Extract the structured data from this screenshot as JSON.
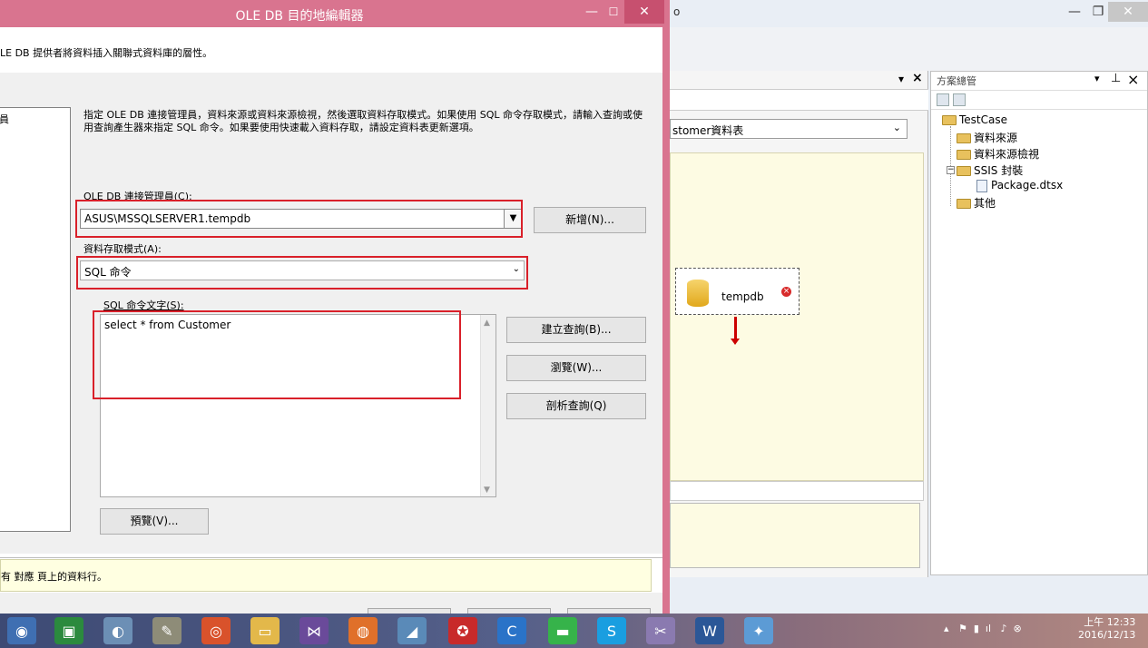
{
  "dialog": {
    "title": "OLE DB 目的地編輯器",
    "description": "LE DB 提供者將資料插入關聯式資料庫的層性。",
    "nav_item": "員",
    "instructions": "指定 OLE DB 連接管理員，資料來源或資料來源檢視，然後選取資料存取模式。如果使用 SQL 命令存取模式，請輸入查詢或使用查詢產生器來指定 SQL 命令。如果要使用快速載入資料存取，請設定資料表更新選項。",
    "connection_label": "OLE DB 連接管理員(C):",
    "connection_value": "ASUS\\MSSQLSERVER1.tempdb",
    "new_button": "新增(N)...",
    "mode_label": "資料存取模式(A):",
    "mode_value": "SQL 命令",
    "sql_label": "SQL 命令文字(S):",
    "sql_text": "select * from Customer",
    "build_query_button": "建立查詢(B)...",
    "browse_button": "瀏覽(W)...",
    "parse_query_button": "剖析查詢(Q)",
    "preview_button": "預覽(V)...",
    "message": "有 對應 頁上的資料行。",
    "min_icon": "—",
    "max_icon": "☐",
    "close_icon": "✕"
  },
  "background": {
    "title_fragment": "o",
    "min_icon": "—",
    "max_icon": "❐",
    "close_icon": "✕",
    "table_select": "stomer資料表",
    "task_label": "tempdb"
  },
  "solution_explorer": {
    "title": "方案總管",
    "items": [
      "TestCase",
      "資料來源",
      "資料來源檢視",
      "SSIS 封裝",
      "Package.dtsx",
      "其他"
    ],
    "expand_icon": "−"
  },
  "taskbar": {
    "clock_time": "上午 12:33",
    "clock_date": "2016/12/13"
  },
  "colors": {
    "dialog_accent": "#d9748f",
    "highlight": "#d9202a",
    "message_bg": "#ffffe1",
    "canvas_bg": "#fdfbe3"
  }
}
